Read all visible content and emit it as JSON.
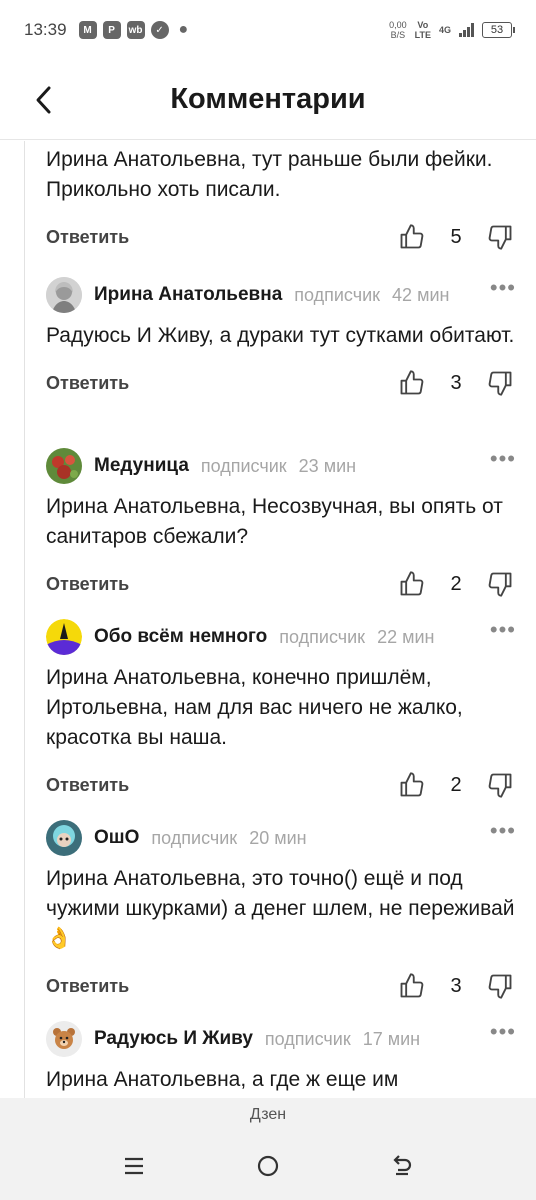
{
  "status_bar": {
    "time": "13:39",
    "speed_value": "0,00",
    "speed_unit": "B/S",
    "volte_top": "Vo",
    "volte_bottom": "LTE",
    "network": "4G",
    "battery": "53"
  },
  "header": {
    "title": "Комментарии"
  },
  "labels": {
    "reply": "Ответить",
    "subscriber": "подписчик",
    "more": "•••"
  },
  "comments": [
    {
      "author": "",
      "time": "",
      "text": "Ирина Анатольевна, тут раньше были фейки. Прикольно хоть писали.",
      "likes": "5"
    },
    {
      "author": "Ирина Анатольевна",
      "time": "42 мин",
      "text": "Радуюсь И Живу, а дураки тут сутками обитают.",
      "likes": "3"
    },
    {
      "author": "Медуница",
      "time": "23 мин",
      "text": "Ирина Анатольевна, Несозвучная, вы опять от санитаров сбежали?",
      "likes": "2"
    },
    {
      "author": "Обо всём немного",
      "time": "22 мин",
      "text": "Ирина Анатольевна, конечно пришлём, Иртольевна, нам для вас ничего не жалко, красотка вы наша.",
      "likes": "2"
    },
    {
      "author": "ОшО",
      "time": "20 мин",
      "text": "Ирина Анатольевна, это точно() ещё и под чужими шкурками) а денег шлем, не переживай",
      "emoji": "👌",
      "likes": "3"
    },
    {
      "author": "Радуюсь И Живу",
      "time": "17 мин",
      "text": "Ирина Анатольевна, а где ж еще им",
      "likes": ""
    }
  ],
  "bottom_bar": {
    "app_name": "Дзен"
  }
}
